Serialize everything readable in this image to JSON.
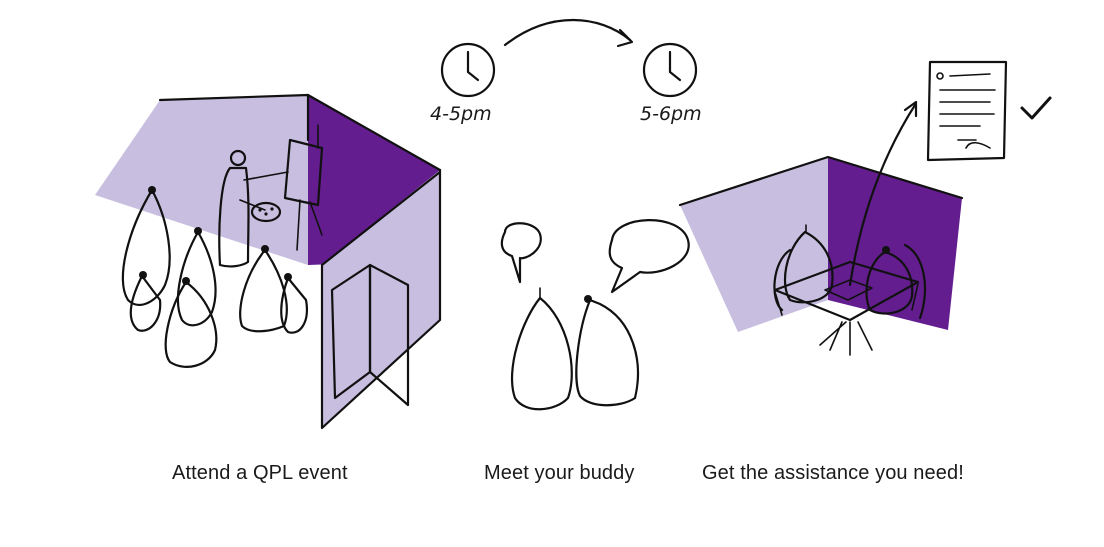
{
  "steps": [
    {
      "caption": "Attend a QPL event"
    },
    {
      "caption": "Meet your buddy"
    },
    {
      "caption": "Get the assistance you need!"
    }
  ],
  "times": {
    "start": "4-5pm",
    "end": "5-6pm"
  },
  "colors": {
    "light_purple": "#c8bfe0",
    "dark_purple": "#631d8e",
    "light_grey": "#ececec",
    "mid_grey": "#9c9c9c",
    "ink": "#111111"
  },
  "icons": [
    "clock-icon",
    "clock-icon",
    "speech-bubble-icon",
    "document-icon",
    "checkmark-icon"
  ]
}
